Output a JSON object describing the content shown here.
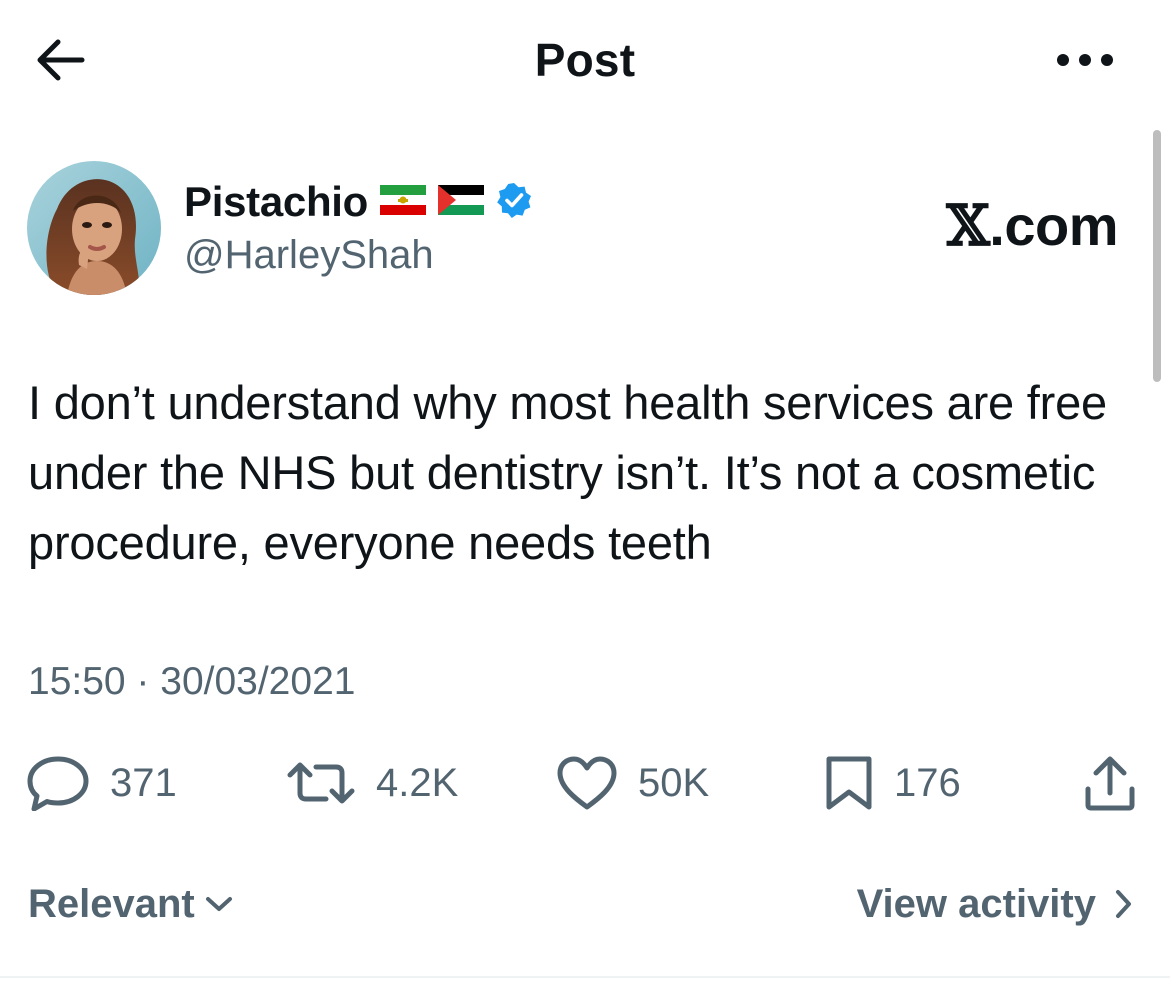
{
  "header": {
    "title": "Post",
    "back_icon": "arrow-left-icon",
    "more_icon": "more-horizontal-icon"
  },
  "author": {
    "display_name": "Pistachio",
    "flags": [
      "iran-lion-and-sun-flag",
      "palestine-flag"
    ],
    "verified": true,
    "handle": "@HarleyShah"
  },
  "watermark": {
    "x": "𝕏",
    "text": ".com"
  },
  "post": {
    "text": "I don’t understand why most health services are free under the NHS but dentistry isn’t. It’s not a cosmetic procedure, everyone needs teeth",
    "timestamp": "15:50 · 30/03/2021"
  },
  "actions": {
    "replies": "371",
    "reposts": "4.2K",
    "likes": "50K",
    "bookmarks": "176"
  },
  "footer": {
    "sort_label": "Relevant",
    "activity_label": "View activity"
  },
  "colors": {
    "text": "#0f1419",
    "secondary": "#536471",
    "verified_blue": "#1d9bf0"
  }
}
